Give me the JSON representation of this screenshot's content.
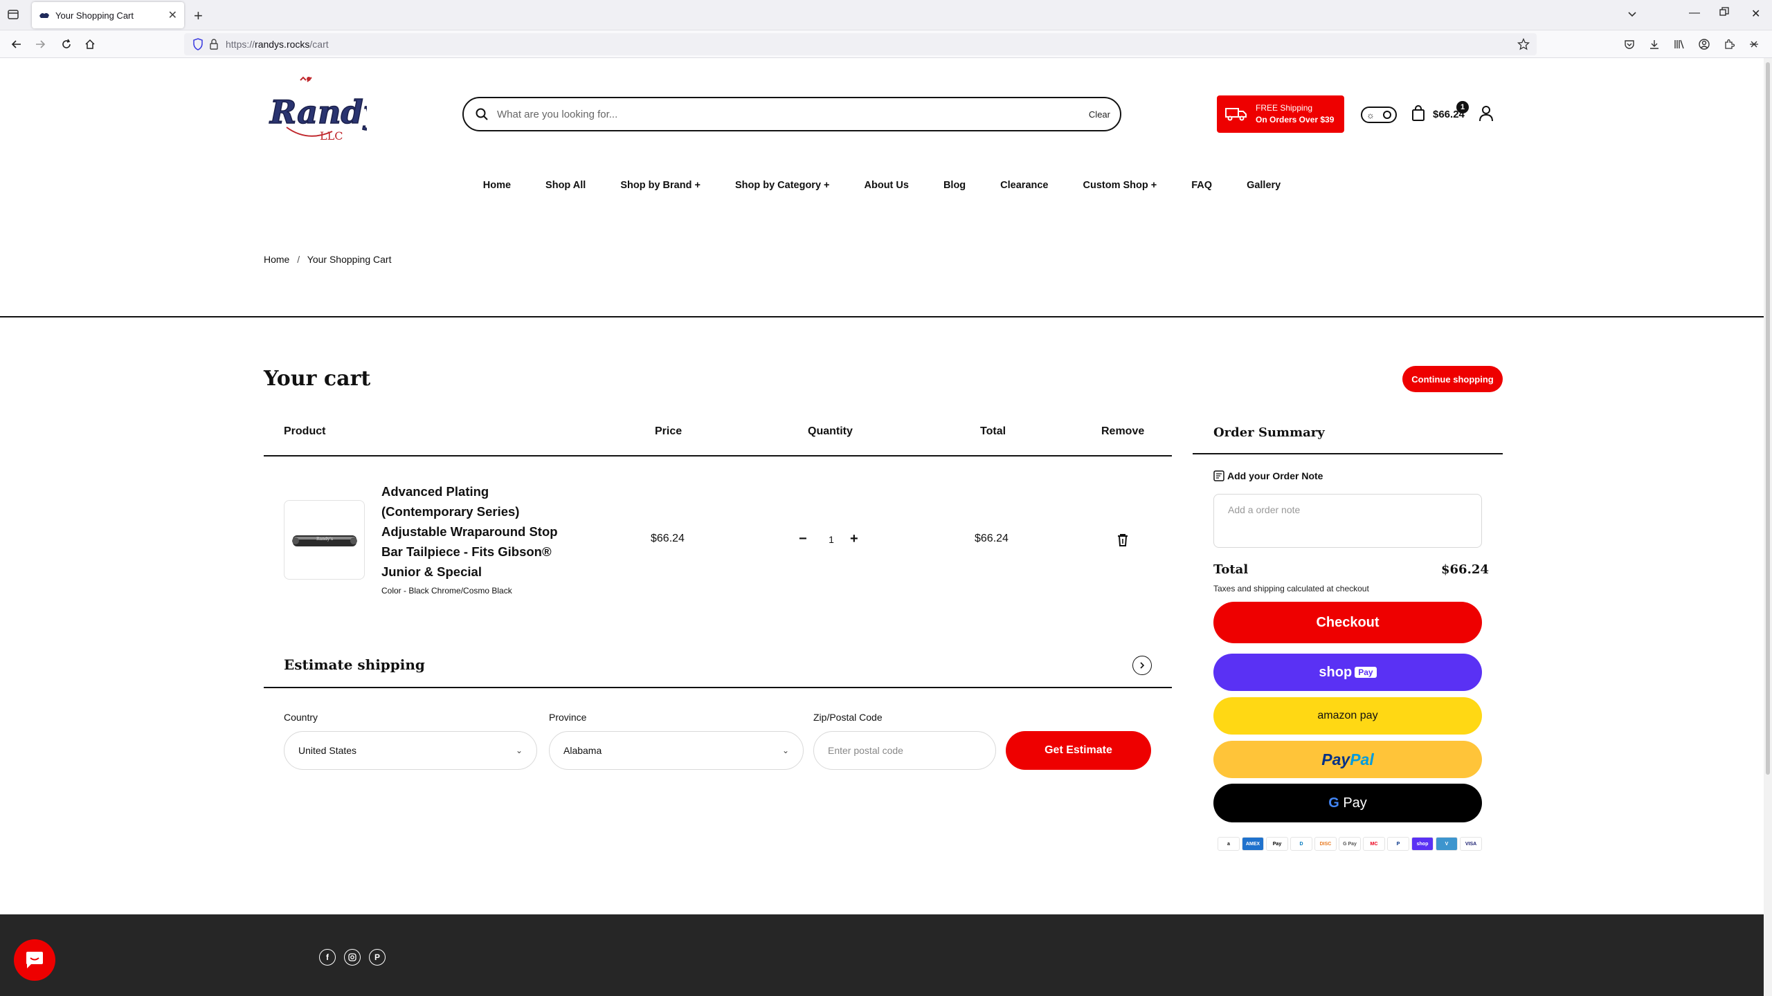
{
  "browser": {
    "tab_title": "Your Shopping Cart",
    "url_proto": "https://",
    "url_host": "randys.rocks",
    "url_path": "/cart"
  },
  "header": {
    "logo_text": "Randy's",
    "logo_sub": "LLC",
    "search_placeholder": "What are you looking for...",
    "search_clear": "Clear",
    "free_ship_line1": "FREE Shipping",
    "free_ship_line2": "On Orders Over $39",
    "cart_count": "1",
    "cart_amount": "$66.24"
  },
  "nav": {
    "home": "Home",
    "shop_all": "Shop All",
    "shop_by_brand": "Shop by Brand +",
    "shop_by_category": "Shop by Category +",
    "about_us": "About Us",
    "blog": "Blog",
    "clearance": "Clearance",
    "custom_shop": "Custom Shop +",
    "faq": "FAQ",
    "gallery": "Gallery"
  },
  "breadcrumb": {
    "home": "Home",
    "sep": "/",
    "current": "Your Shopping Cart"
  },
  "cart": {
    "title": "Your cart",
    "continue": "Continue shopping",
    "columns": {
      "product": "Product",
      "price": "Price",
      "quantity": "Quantity",
      "total": "Total",
      "remove": "Remove"
    },
    "item": {
      "name": "Advanced Plating (Contemporary Series) Adjustable Wraparound Stop Bar Tailpiece - Fits Gibson® Junior & Special",
      "variant": "Color - Black Chrome/Cosmo Black",
      "price": "$66.24",
      "quantity": "1",
      "total": "$66.24"
    }
  },
  "shipping": {
    "title": "Estimate shipping",
    "country_label": "Country",
    "country_value": "United States",
    "province_label": "Province",
    "province_value": "Alabama",
    "zip_label": "Zip/Postal Code",
    "zip_placeholder": "Enter postal code",
    "button": "Get Estimate"
  },
  "summary": {
    "title": "Order Summary",
    "note_label": "Add your Order Note",
    "note_placeholder": "Add a order note",
    "total_label": "Total",
    "total_value": "$66.24",
    "taxes_note": "Taxes and shipping calculated at checkout",
    "checkout": "Checkout",
    "shoppay": "shop",
    "shoppay_tag": "Pay",
    "amazonpay": "amazon pay",
    "paypal_a": "Pay",
    "paypal_b": "Pal",
    "gpay_g": "G",
    "gpay": "Pay",
    "cards": [
      "a",
      "AMEX",
      "Pay",
      "D",
      "DISC",
      "G Pay",
      "MC",
      "P",
      "shop",
      "V",
      "VISA"
    ]
  },
  "colors": {
    "brand_red": "#ee0000",
    "shop_pay": "#5a31f4",
    "amazon_yellow": "#ffd814",
    "paypal_yellow": "#ffc439",
    "footer": "#262626"
  }
}
